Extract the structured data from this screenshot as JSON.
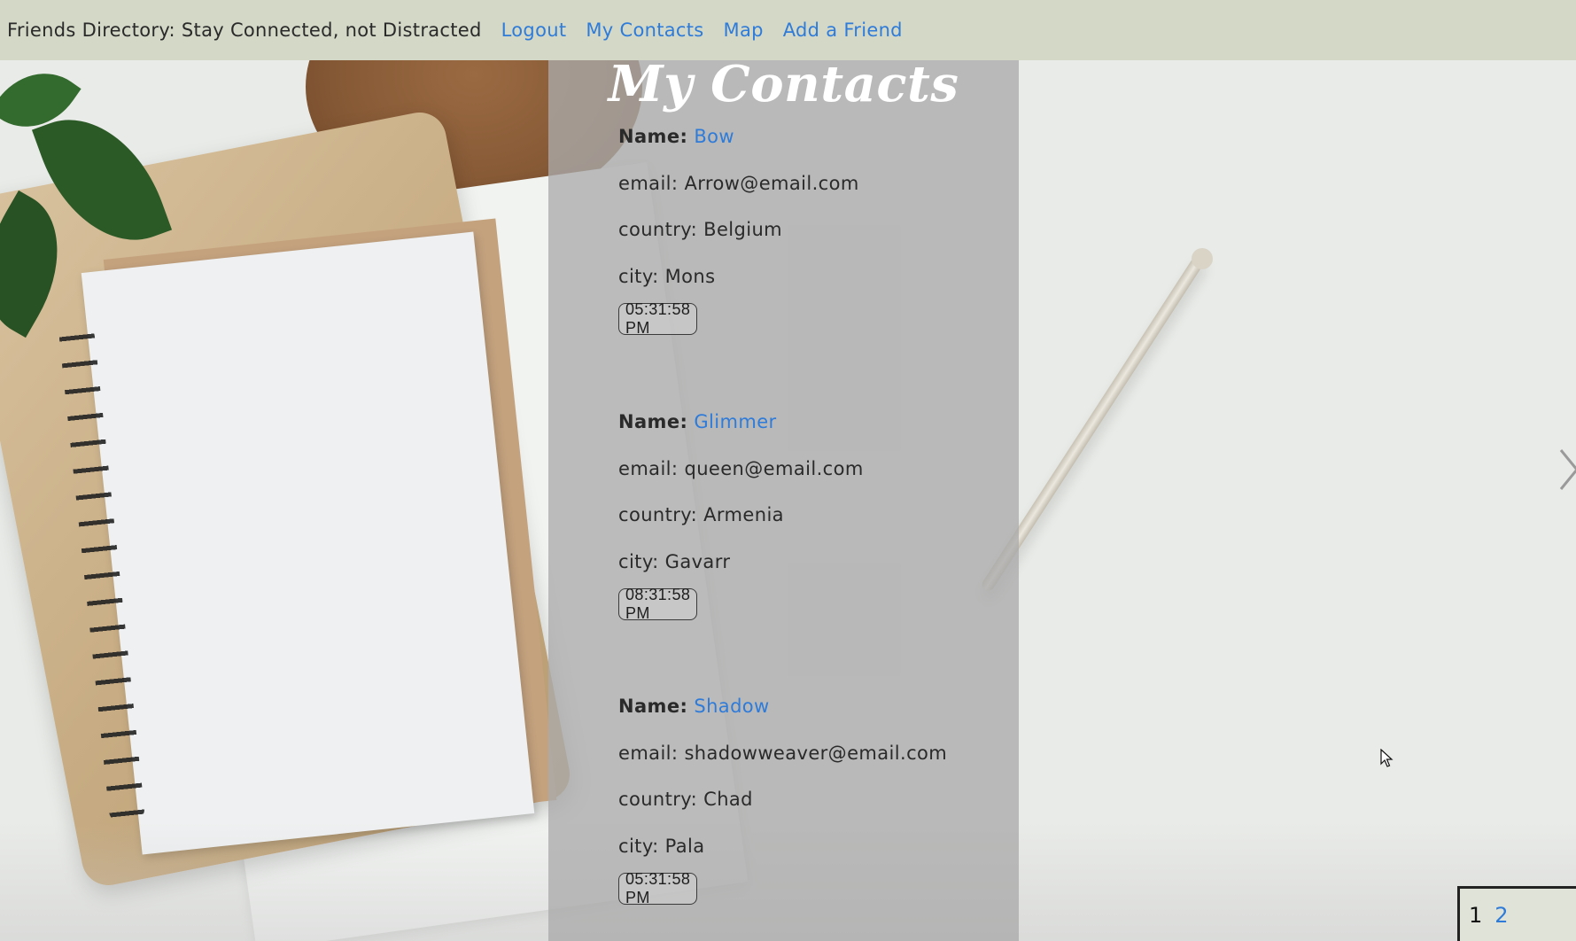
{
  "nav": {
    "brand": "Friends Directory: Stay Connected, not Distracted",
    "links": [
      "Logout",
      "My Contacts",
      "Map",
      "Add a Friend"
    ]
  },
  "page": {
    "title": "My Contacts"
  },
  "contacts": [
    {
      "name_label": "Name:",
      "name": "Bow",
      "email": "email: Arrow@email.com",
      "country": "country: Belgium",
      "city": "city: Mons",
      "time": "05:31:58 PM"
    },
    {
      "name_label": "Name:",
      "name": "Glimmer",
      "email": "email: queen@email.com",
      "country": "country: Armenia",
      "city": "city: Gavarr",
      "time": "08:31:58 PM"
    },
    {
      "name_label": "Name:",
      "name": "Shadow",
      "email": "email: shadowweaver@email.com",
      "country": "country: Chad",
      "city": "city: Pala",
      "time": "05:31:58 PM"
    }
  ],
  "pagination": {
    "pages": [
      "1",
      "2"
    ],
    "current": "1"
  },
  "colors": {
    "nav_bg": "#d3d8c7",
    "link": "#2f7bd9",
    "panel_bg": "#aaaaaa"
  },
  "icons": {
    "next": "chevron-right-icon",
    "cursor": "mouse-pointer-icon"
  }
}
